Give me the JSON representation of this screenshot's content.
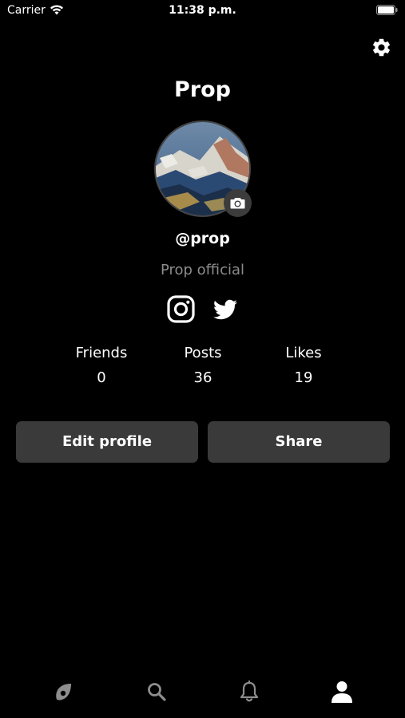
{
  "status_bar": {
    "carrier": "Carrier",
    "time": "11:38 p.m."
  },
  "profile": {
    "title": "Prop",
    "handle": "@prop",
    "bio": "Prop official"
  },
  "stats": [
    {
      "label": "Friends",
      "value": "0"
    },
    {
      "label": "Posts",
      "value": "36"
    },
    {
      "label": "Likes",
      "value": "19"
    }
  ],
  "actions": {
    "edit_label": "Edit profile",
    "share_label": "Share"
  },
  "icons": {
    "settings": "gear-icon",
    "camera": "camera-icon",
    "instagram": "instagram-icon",
    "twitter": "twitter-icon",
    "tabs": [
      "feed-icon",
      "search-icon",
      "bell-icon",
      "profile-icon"
    ]
  },
  "colors": {
    "background": "#000000",
    "button": "#3a3a3a",
    "muted_text": "#8c8c8c",
    "inactive_tab": "#8e8e8e",
    "active_tab": "#ffffff"
  }
}
